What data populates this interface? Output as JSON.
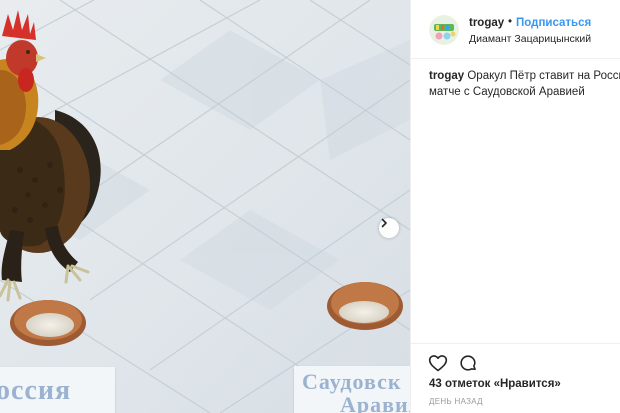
{
  "post": {
    "username": "trogay",
    "separator": "•",
    "follow_label": "Подписаться",
    "location": "Диамант Зацарицынский",
    "caption": {
      "username": "trogay",
      "line1": "Оракул Пётр ставит на Россию в",
      "line2": "матче с Саудовской Аравией"
    },
    "likes_text": "43 отметок «Нравится»",
    "time_text": "ДЕНЬ НАЗАД"
  },
  "photo": {
    "sign_left": "оссия",
    "sign_right_line1": "Саудовск",
    "sign_right_line2": "Аравия"
  },
  "icons": {
    "next": "chevron-right-icon",
    "like": "heart-outline-icon",
    "comment": "comment-bubble-icon"
  },
  "colors": {
    "accent": "#3897f0",
    "text": "#262626",
    "muted": "#999999",
    "sign_text": "#9bb3d1"
  }
}
